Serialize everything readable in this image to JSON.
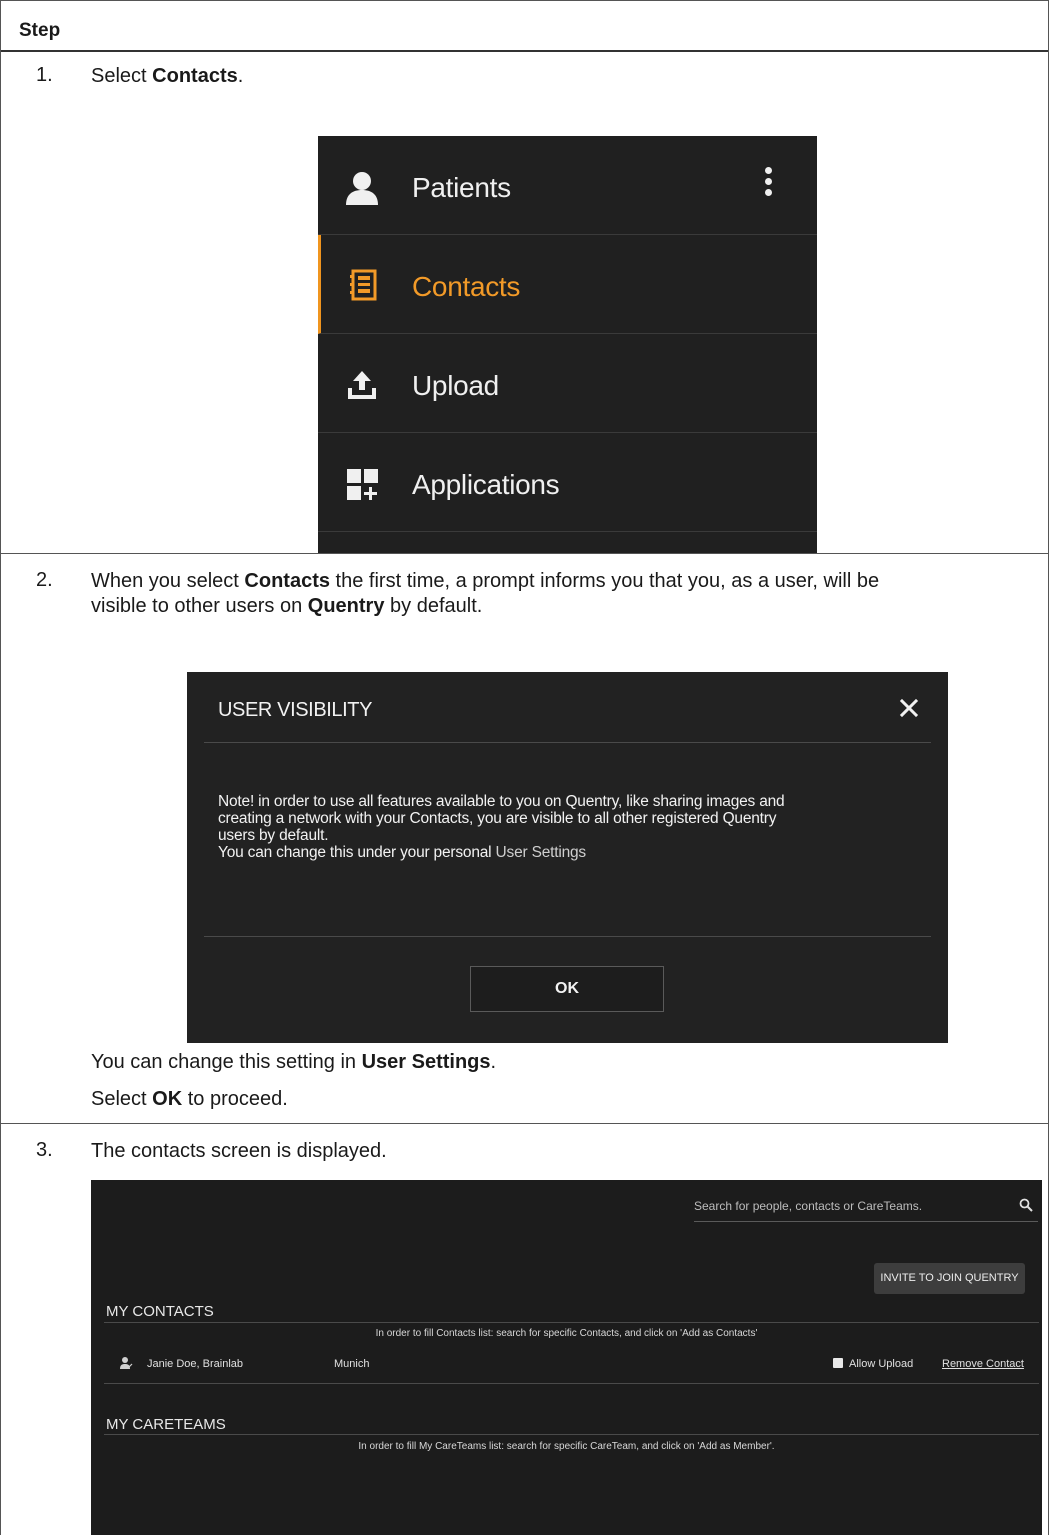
{
  "table": {
    "header": "Step"
  },
  "step1": {
    "number": "1.",
    "text_prefix": "Select ",
    "text_bold": "Contacts",
    "text_suffix": ".",
    "menu": {
      "items": [
        {
          "label": "Patients",
          "icon": "person-icon"
        },
        {
          "label": "Contacts",
          "icon": "address-book-icon",
          "active": true
        },
        {
          "label": "Upload",
          "icon": "upload-icon"
        },
        {
          "label": "Applications",
          "icon": "applications-icon"
        }
      ],
      "accent_color": "#f0951f"
    }
  },
  "step2": {
    "number": "2.",
    "line1_prefix": "When you select ",
    "line1_bold": "Contacts",
    "line1_suffix": " the first time, a prompt informs you that you, as a user, will be",
    "line2_prefix": "visible to other users on ",
    "line2_bold": "Quentry",
    "line2_suffix": " by default.",
    "dialog": {
      "title": "USER VISIBILITY",
      "body_line1": "Note! in order to use all features available to you on Quentry, like sharing images and",
      "body_line2": "creating a network with your Contacts, you are visible to all other registered Quentry",
      "body_line3": "users by default.",
      "body_line4_prefix": "You can change this under your personal ",
      "body_line4_link": "User Settings",
      "ok_label": "OK"
    },
    "after1_prefix": "You can change this setting in ",
    "after1_bold": "User Settings",
    "after1_suffix": ".",
    "after2_prefix": "Select ",
    "after2_bold": "OK",
    "after2_suffix": " to proceed."
  },
  "step3": {
    "number": "3.",
    "text": "The contacts screen is displayed.",
    "screen": {
      "search_placeholder": "Search for people, contacts or CareTeams.",
      "invite_label": "INVITE TO JOIN QUENTRY",
      "my_contacts_title": "MY CONTACTS",
      "contacts_hint": "In order to fill Contacts list: search for specific Contacts, and click on 'Add as Contacts'",
      "contact": {
        "name": "Janie Doe, Brainlab",
        "city": "Munich",
        "allow_upload_label": "Allow Upload",
        "remove_label": "Remove Contact"
      },
      "my_careteams_title": "MY CARETEAMS",
      "careteams_hint": "In order to fill My CareTeams list: search for specific CareTeam, and click on 'Add as Member'."
    }
  }
}
